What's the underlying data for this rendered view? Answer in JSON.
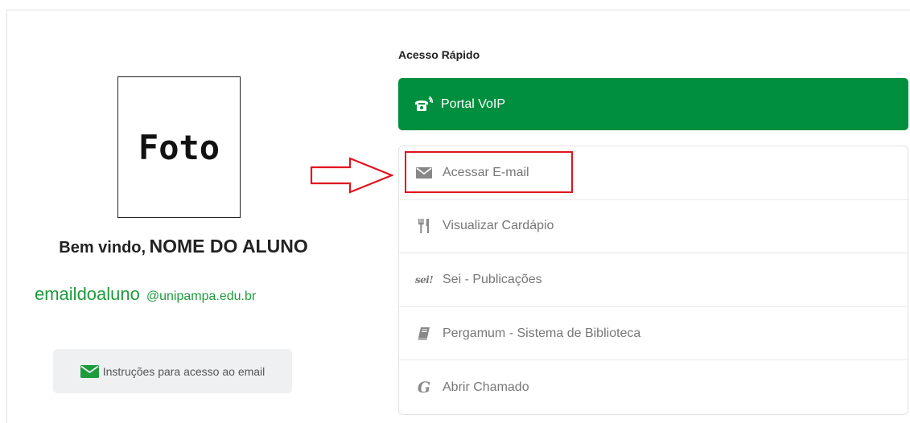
{
  "profile": {
    "photo_label": "Foto",
    "greeting": "Bem vindo,",
    "student_name": "NOME DO ALUNO",
    "email_user": "emaildoaluno",
    "email_domain": "@unipampa.edu.br",
    "instructions_label": "Instruções para acesso ao email"
  },
  "quick_access": {
    "title": "Acesso Rápido",
    "voip_label": "Portal VoIP",
    "items": [
      {
        "label": "Acessar E-mail",
        "icon": "envelope-icon"
      },
      {
        "label": "Visualizar Cardápio",
        "icon": "cutlery-icon"
      },
      {
        "label": "Sei - Publicações",
        "icon": "sei-icon",
        "icon_text": "sei!"
      },
      {
        "label": "Pergamum - Sistema de Biblioteca",
        "icon": "book-icon"
      },
      {
        "label": "Abrir Chamado",
        "icon": "g-icon",
        "icon_text": "G"
      }
    ]
  },
  "colors": {
    "voip_bg": "#008f3f",
    "email_text": "#1e9b3c",
    "annotation_red": "#e0141e"
  }
}
